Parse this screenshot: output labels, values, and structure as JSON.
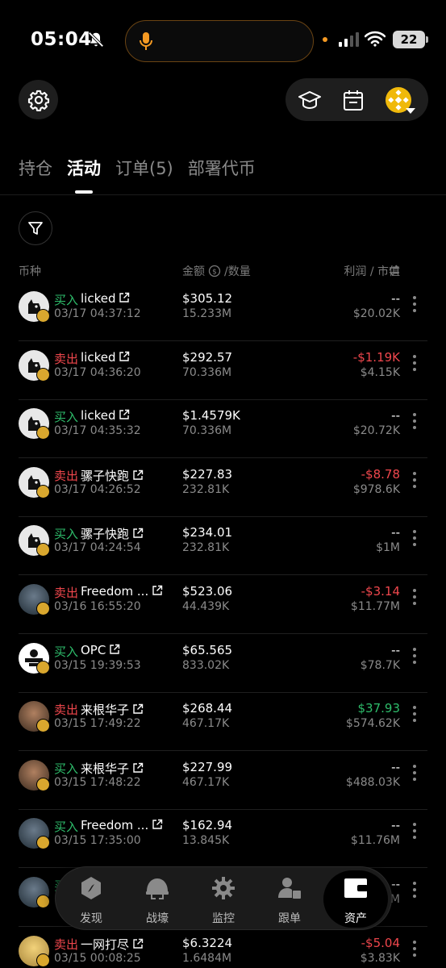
{
  "status_bar": {
    "time": "05:04",
    "battery": "22"
  },
  "tabs": [
    {
      "label": "持仓",
      "active": false
    },
    {
      "label": "活动",
      "active": true
    },
    {
      "label": "订单(5)",
      "active": false
    },
    {
      "label": "部署代币",
      "active": false
    }
  ],
  "columns": {
    "coin": "币种",
    "amount": "金额",
    "quantity": "/数量",
    "profit_mcap": "利润 / 市值"
  },
  "rows": [
    {
      "side": "买入",
      "type": "buy",
      "name": "licked",
      "datetime": "03/17 04:37:12",
      "amount": "$305.12",
      "quantity": "15.233M",
      "profit": "--",
      "profit_type": "none",
      "mcap": "$20.02K"
    },
    {
      "side": "卖出",
      "type": "sell",
      "name": "licked",
      "datetime": "03/17 04:36:20",
      "amount": "$292.57",
      "quantity": "70.336M",
      "profit": "-$1.19K",
      "profit_type": "neg",
      "mcap": "$4.15K"
    },
    {
      "side": "买入",
      "type": "buy",
      "name": "licked",
      "datetime": "03/17 04:35:32",
      "amount": "$1.4579K",
      "quantity": "70.336M",
      "profit": "--",
      "profit_type": "none",
      "mcap": "$20.72K"
    },
    {
      "side": "卖出",
      "type": "sell",
      "name": "骡子快跑",
      "datetime": "03/17 04:26:52",
      "amount": "$227.83",
      "quantity": "232.81K",
      "profit": "-$8.78",
      "profit_type": "neg",
      "mcap": "$978.6K"
    },
    {
      "side": "买入",
      "type": "buy",
      "name": "骡子快跑",
      "datetime": "03/17 04:24:54",
      "amount": "$234.01",
      "quantity": "232.81K",
      "profit": "--",
      "profit_type": "none",
      "mcap": "$1M"
    },
    {
      "side": "卖出",
      "type": "sell",
      "name": "Freedom ...",
      "datetime": "03/16 16:55:20",
      "amount": "$523.06",
      "quantity": "44.439K",
      "profit": "-$3.14",
      "profit_type": "neg",
      "mcap": "$11.77M"
    },
    {
      "side": "买入",
      "type": "buy",
      "name": "OPC",
      "datetime": "03/15 19:39:53",
      "amount": "$65.565",
      "quantity": "833.02K",
      "profit": "--",
      "profit_type": "none",
      "mcap": "$78.7K"
    },
    {
      "side": "卖出",
      "type": "sell",
      "name": "来根华子",
      "datetime": "03/15 17:49:22",
      "amount": "$268.44",
      "quantity": "467.17K",
      "profit": "$37.93",
      "profit_type": "pos",
      "mcap": "$574.62K"
    },
    {
      "side": "买入",
      "type": "buy",
      "name": "来根华子",
      "datetime": "03/15 17:48:22",
      "amount": "$227.99",
      "quantity": "467.17K",
      "profit": "--",
      "profit_type": "none",
      "mcap": "$488.03K"
    },
    {
      "side": "买入",
      "type": "buy",
      "name": "Freedom ...",
      "datetime": "03/15 17:35:00",
      "amount": "$162.94",
      "quantity": "13.845K",
      "profit": "--",
      "profit_type": "none",
      "mcap": "$11.76M"
    },
    {
      "side": "买入",
      "type": "buy",
      "name": "",
      "datetime": "",
      "amount": "",
      "quantity": "",
      "profit": "--",
      "profit_type": "none",
      "mcap": "M"
    },
    {
      "side": "卖出",
      "type": "sell",
      "name": "一网打尽",
      "datetime": "03/15 00:08:25",
      "amount": "$6.3224",
      "quantity": "1.6484M",
      "profit": "-$5.04",
      "profit_type": "neg",
      "mcap": "$3.83K"
    }
  ],
  "nav": [
    {
      "label": "发现",
      "icon": "compass-icon"
    },
    {
      "label": "战壕",
      "icon": "helmet-icon"
    },
    {
      "label": "监控",
      "icon": "monitor-gear-icon"
    },
    {
      "label": "跟单",
      "icon": "copy-trade-icon"
    },
    {
      "label": "资产",
      "icon": "wallet-icon",
      "active": true
    }
  ],
  "colors": {
    "buy": "#2ebd6b",
    "sell": "#f0474d",
    "badge": "#d9a72e"
  }
}
